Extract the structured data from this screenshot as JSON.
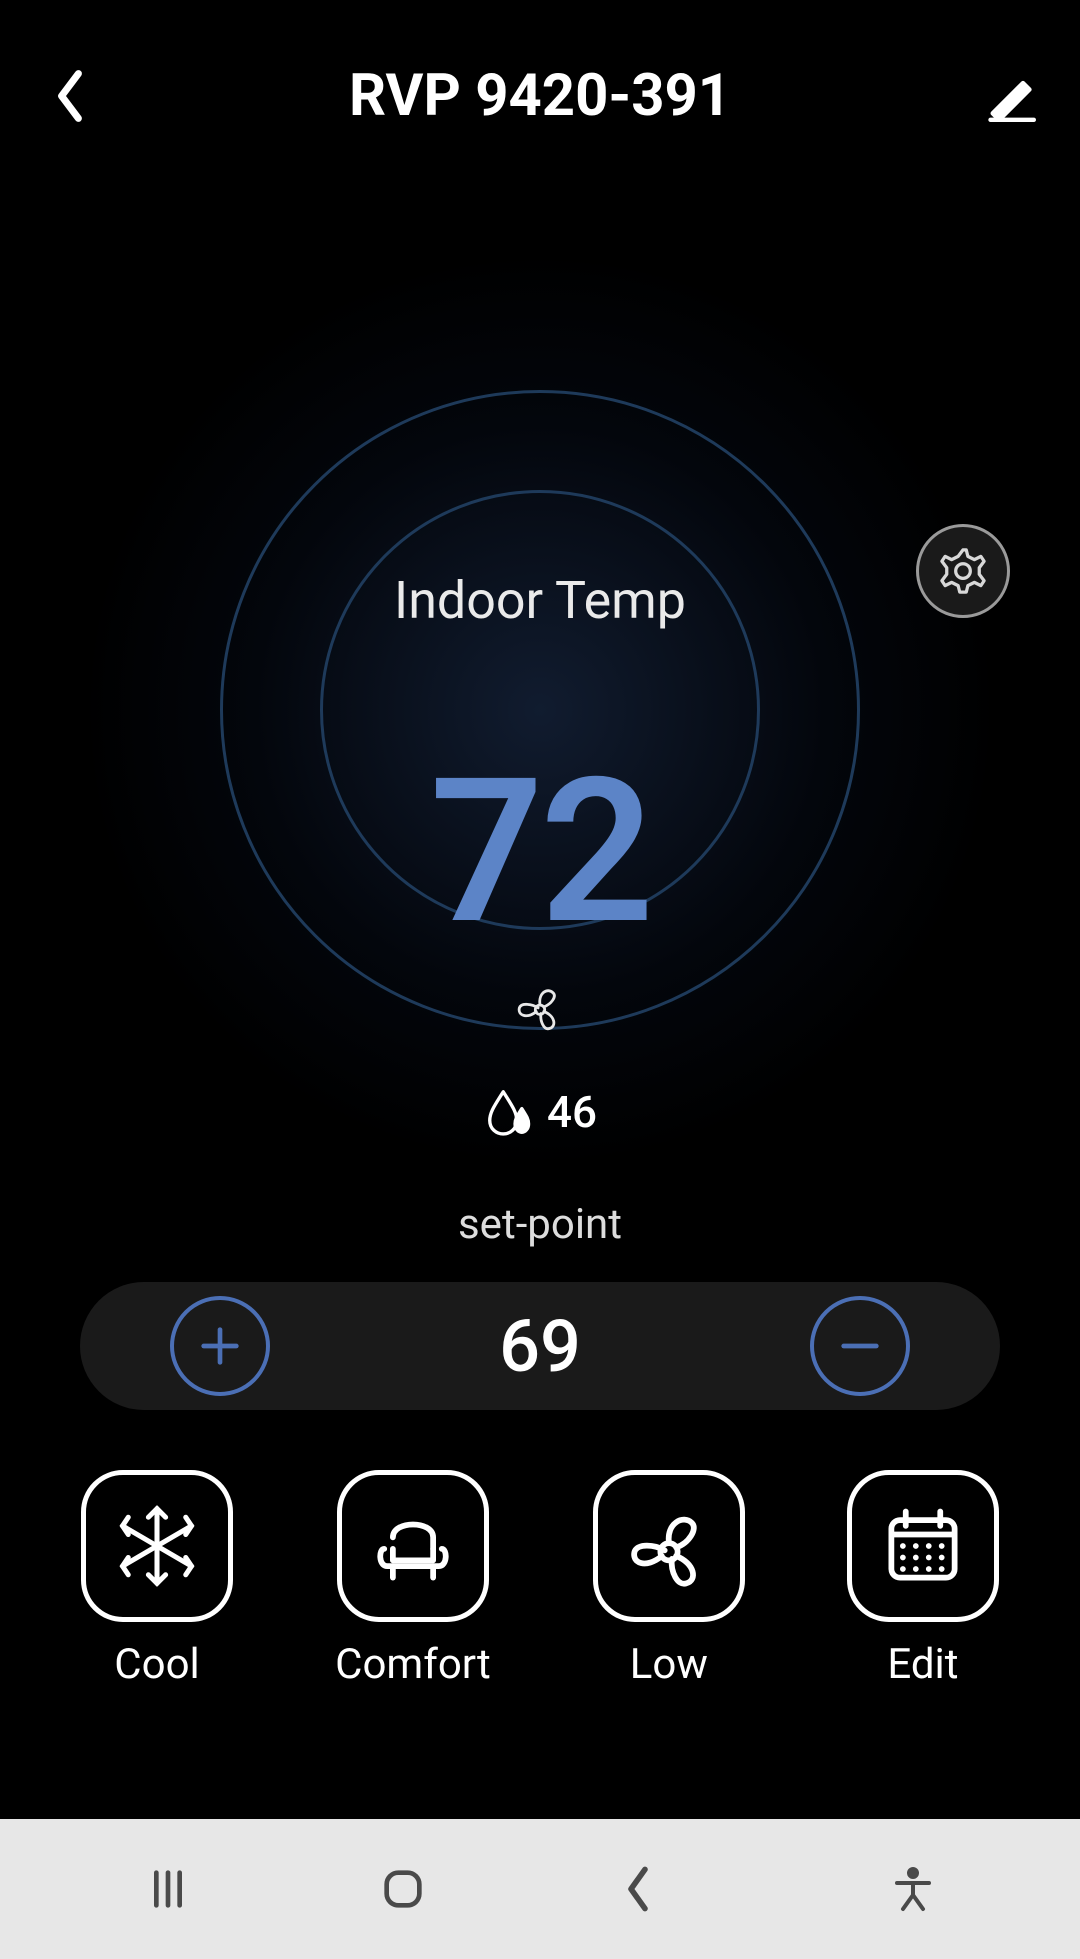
{
  "header": {
    "title": "RVP 9420-391",
    "back_icon": "chevron-left",
    "edit_icon": "pencil"
  },
  "dial": {
    "label": "Indoor Temp",
    "temperature": "72",
    "fan_icon": "fan",
    "humidity_icon": "humidity-drops",
    "humidity": "46",
    "gear_icon": "gear"
  },
  "setpoint": {
    "label": "set-point",
    "value": "69",
    "plus_icon": "plus",
    "minus_icon": "minus"
  },
  "modes": [
    {
      "id": "cool",
      "label": "Cool",
      "icon": "snowflake"
    },
    {
      "id": "comfort",
      "label": "Comfort",
      "icon": "armchair"
    },
    {
      "id": "low",
      "label": "Low",
      "icon": "fan"
    },
    {
      "id": "edit",
      "label": "Edit",
      "icon": "calendar"
    }
  ],
  "navbar": {
    "recent_icon": "recent-apps",
    "home_icon": "home-pill",
    "back_icon": "chevron-left",
    "accessibility_icon": "accessibility"
  },
  "colors": {
    "accent_blue": "#5c84c7",
    "ring_blue": "#1e3a5a",
    "button_blue": "#4b6fb5",
    "navbar_bg": "#e7e7e7"
  }
}
